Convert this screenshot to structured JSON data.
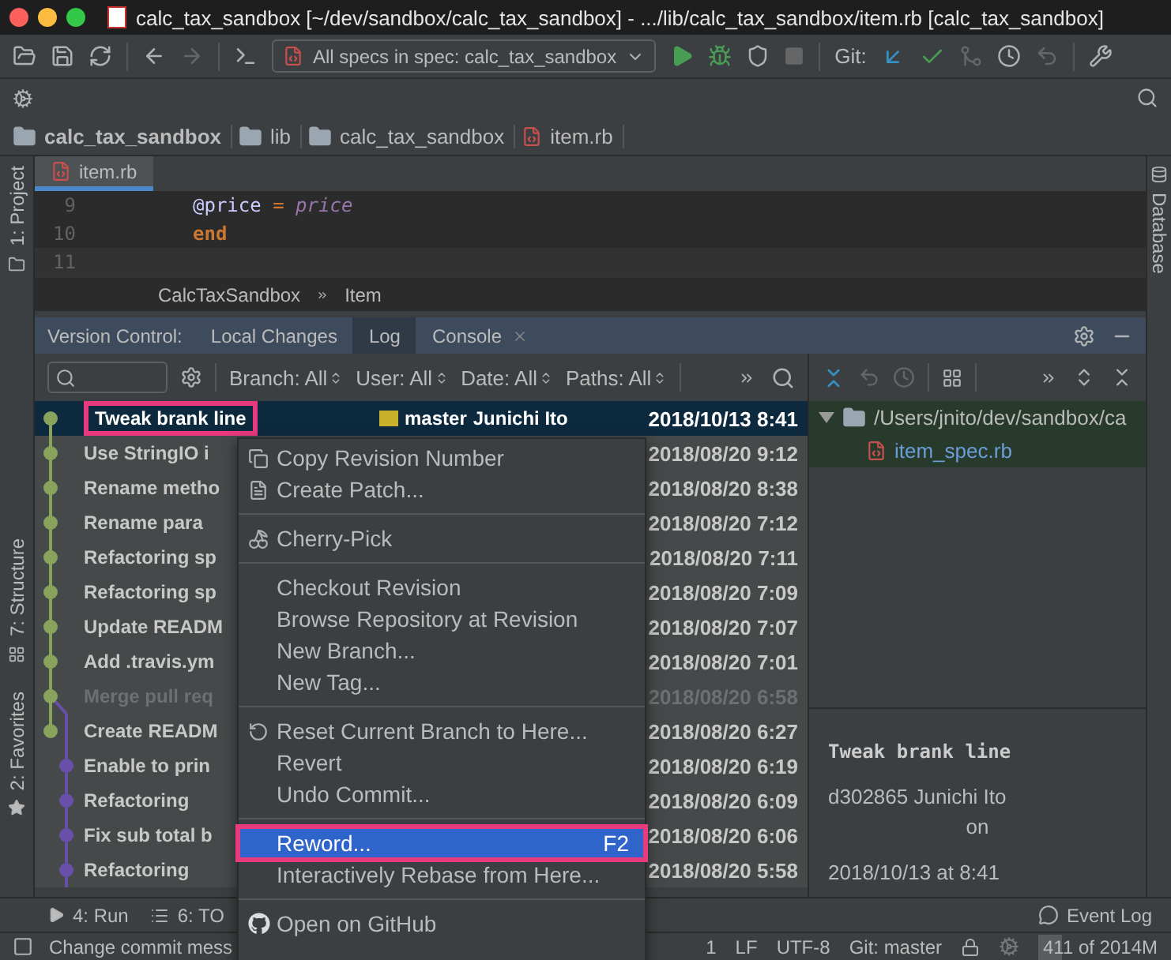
{
  "window": {
    "title": "calc_tax_sandbox [~/dev/sandbox/calc_tax_sandbox] - .../lib/calc_tax_sandbox/item.rb [calc_tax_sandbox]"
  },
  "toolbar": {
    "run_config": "All specs in spec: calc_tax_sandbox",
    "git_label": "Git:"
  },
  "nav_bar": [
    {
      "label": "calc_tax_sandbox",
      "kind": "project"
    },
    {
      "label": "lib",
      "kind": "folder"
    },
    {
      "label": "calc_tax_sandbox",
      "kind": "folder"
    },
    {
      "label": "item.rb",
      "kind": "file"
    }
  ],
  "left_stripe": [
    {
      "label": "1: Project",
      "kind": "project"
    },
    {
      "label": "7: Structure",
      "kind": "structure"
    },
    {
      "label": "2: Favorites",
      "kind": "favorites"
    }
  ],
  "right_stripe": [
    {
      "label": "Database"
    }
  ],
  "editor": {
    "tabs": [
      {
        "label": "item.rb",
        "selected": true
      }
    ],
    "lines": [
      {
        "number": "9",
        "tokens": [
          {
            "text": "@price",
            "kind": "ivar"
          },
          {
            "text": " = ",
            "kind": "op"
          },
          {
            "text": "price",
            "kind": "param"
          }
        ]
      },
      {
        "number": "10",
        "tokens": [
          {
            "text": "end",
            "kind": "keyword"
          }
        ]
      },
      {
        "number": "11"
      }
    ],
    "breadcrumbs": [
      "CalcTaxSandbox",
      "Item"
    ]
  },
  "tool_window": {
    "title": "Version Control:",
    "tabs": [
      {
        "label": "Local Changes",
        "selected": false,
        "closable": false
      },
      {
        "label": "Log",
        "selected": true,
        "closable": false
      },
      {
        "label": "Console",
        "selected": false,
        "closable": true
      }
    ]
  },
  "log": {
    "filters": [
      "Branch: All",
      "User: All",
      "Date: All",
      "Paths: All"
    ],
    "commits": [
      {
        "message": "Tweak brank line",
        "branch": "master",
        "author": "Junichi Ito",
        "date": "2018/10/13 8:41",
        "color": "#88a35c",
        "selected": true,
        "dimmed": false,
        "highlighted": true
      },
      {
        "message": "Use StringIO i",
        "date": "2018/08/20 9:12",
        "color": "#88a35c",
        "selected": false,
        "dimmed": false,
        "highlighted": false
      },
      {
        "message": "Rename metho",
        "date": "2018/08/20 8:38",
        "color": "#88a35c",
        "selected": false,
        "dimmed": false,
        "highlighted": false
      },
      {
        "message": "Rename para",
        "date": "2018/08/20 7:12",
        "color": "#88a35c",
        "selected": false,
        "dimmed": false,
        "highlighted": false
      },
      {
        "message": "Refactoring sp",
        "date": "2018/08/20 7:11",
        "color": "#88a35c",
        "selected": false,
        "dimmed": false,
        "highlighted": false
      },
      {
        "message": "Refactoring sp",
        "date": "2018/08/20 7:09",
        "color": "#88a35c",
        "selected": false,
        "dimmed": false,
        "highlighted": false
      },
      {
        "message": "Update READM",
        "date": "2018/08/20 7:07",
        "color": "#88a35c",
        "selected": false,
        "dimmed": false,
        "highlighted": false
      },
      {
        "message": "Add .travis.ym",
        "date": "2018/08/20 7:01",
        "color": "#88a35c",
        "selected": false,
        "dimmed": false,
        "highlighted": false
      },
      {
        "message": "Merge pull req",
        "date": "2018/08/20 6:58",
        "color": "#88a35c",
        "selected": false,
        "dimmed": true,
        "highlighted": false
      },
      {
        "message": "Create READM",
        "date": "2018/08/20 6:27",
        "color": "#88a35c",
        "selected": false,
        "dimmed": false,
        "highlighted": false
      },
      {
        "message": "Enable to prin",
        "date": "2018/08/20 6:19",
        "color": "#6a4fa8",
        "selected": false,
        "dimmed": false,
        "highlighted": false
      },
      {
        "message": "Refactoring",
        "date": "2018/08/20 6:09",
        "color": "#6a4fa8",
        "selected": false,
        "dimmed": false,
        "highlighted": false
      },
      {
        "message": "Fix sub total b",
        "date": "2018/08/20 6:06",
        "color": "#6a4fa8",
        "selected": false,
        "dimmed": false,
        "highlighted": false
      },
      {
        "message": "Refactoring",
        "date": "2018/08/20 5:58",
        "color": "#6a4fa8",
        "selected": false,
        "dimmed": false,
        "highlighted": false
      }
    ]
  },
  "changes": {
    "tree": [
      {
        "label": "/Users/jnito/dev/sandbox/ca",
        "kind": "folder",
        "expanded": true,
        "children": [
          {
            "label": "item_spec.rb",
            "kind": "file"
          }
        ]
      }
    ]
  },
  "details": {
    "subject": "Tweak brank line",
    "hash_author": "d302865 Junichi Ito",
    "on": "on",
    "date": "2018/10/13 at 8:41"
  },
  "context_menu": [
    {
      "kind": "item",
      "label": "Copy Revision Number",
      "selected": false,
      "highlighted": false
    },
    {
      "kind": "item",
      "label": "Create Patch...",
      "selected": false,
      "highlighted": false
    },
    {
      "kind": "separator"
    },
    {
      "kind": "item",
      "label": "Cherry-Pick",
      "selected": false,
      "highlighted": false
    },
    {
      "kind": "separator"
    },
    {
      "kind": "item",
      "label": "Checkout Revision",
      "selected": false,
      "highlighted": false
    },
    {
      "kind": "item",
      "label": "Browse Repository at Revision",
      "selected": false,
      "highlighted": false
    },
    {
      "kind": "item",
      "label": "New Branch...",
      "selected": false,
      "highlighted": false
    },
    {
      "kind": "item",
      "label": "New Tag...",
      "selected": false,
      "highlighted": false
    },
    {
      "kind": "separator"
    },
    {
      "kind": "item",
      "label": "Reset Current Branch to Here...",
      "selected": false,
      "highlighted": false
    },
    {
      "kind": "item",
      "label": "Revert",
      "selected": false,
      "highlighted": false
    },
    {
      "kind": "item",
      "label": "Undo Commit...",
      "selected": false,
      "highlighted": false
    },
    {
      "kind": "separator"
    },
    {
      "kind": "item",
      "label": "Reword...",
      "shortcut": "F2",
      "selected": true,
      "highlighted": true
    },
    {
      "kind": "item",
      "label": "Interactively Rebase from Here...",
      "selected": false,
      "highlighted": false
    },
    {
      "kind": "separator"
    },
    {
      "kind": "item",
      "label": "Open on GitHub",
      "selected": false,
      "highlighted": false
    }
  ],
  "bottom_bar": {
    "tools": [
      {
        "label": "4: Run",
        "kind": "run"
      },
      {
        "label": "6: TO",
        "kind": "todo"
      }
    ],
    "event_log": "Event Log"
  },
  "status_bar": {
    "message": "Change commit mess",
    "items": [
      "1",
      "LF",
      "UTF-8",
      "Git: master"
    ],
    "memory": {
      "label": "411 of 2014M",
      "level": 0.2
    }
  }
}
